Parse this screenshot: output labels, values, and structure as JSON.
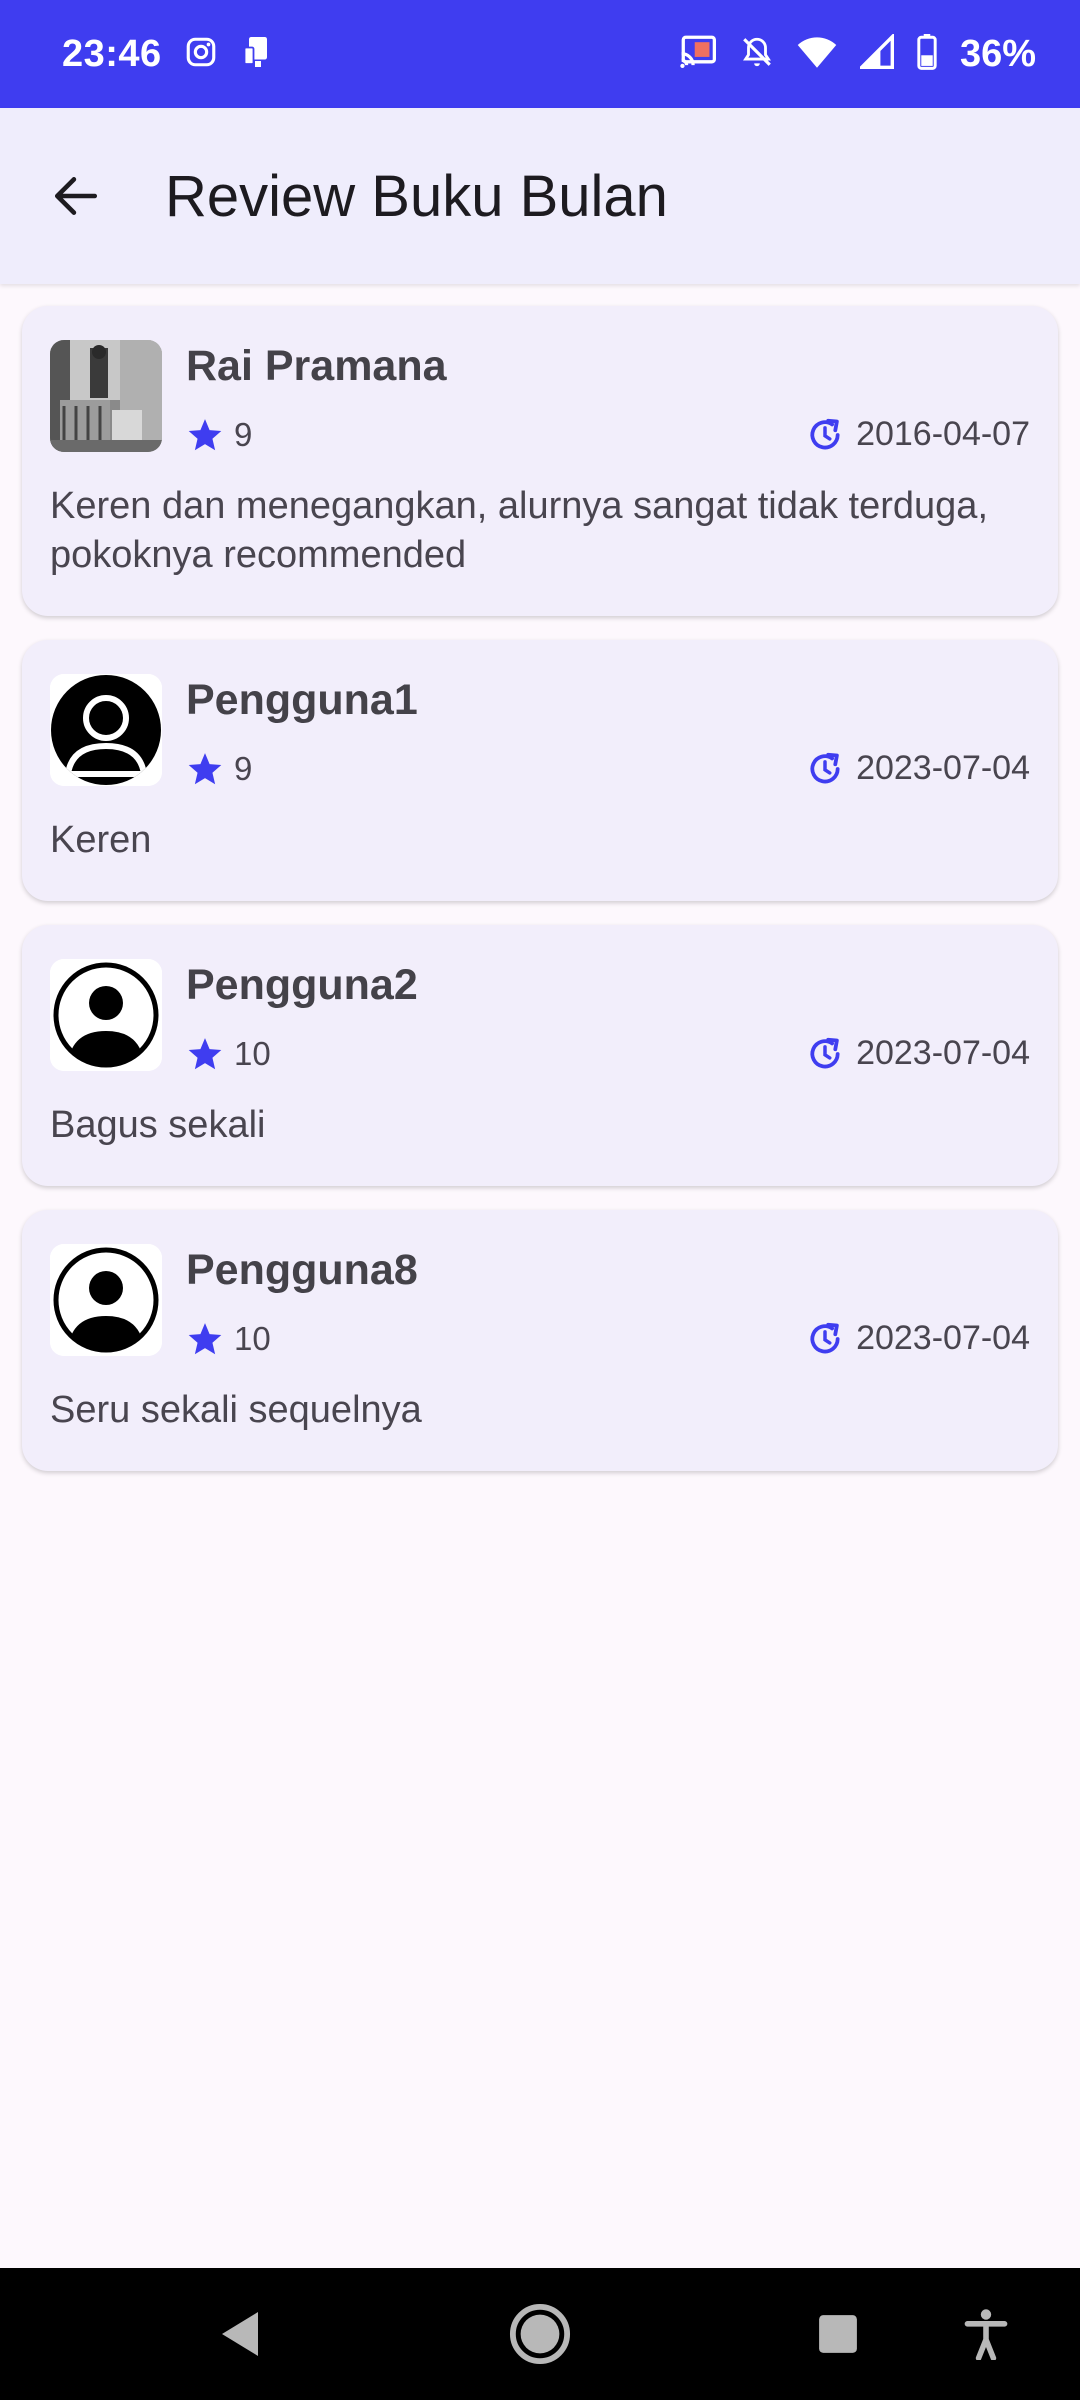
{
  "status_bar": {
    "time": "23:46",
    "battery": "36%",
    "icons_left": [
      "instagram-icon",
      "device-icon"
    ],
    "icons_right": [
      "cast-icon",
      "bell-off-icon",
      "wifi-icon",
      "signal-icon",
      "battery-icon"
    ]
  },
  "app_bar": {
    "title": "Review Buku Bulan",
    "back_icon": "arrow-back-icon"
  },
  "reviews": [
    {
      "name": "Rai Pramana",
      "rating": "9",
      "date": "2016-04-07",
      "text": "Keren dan menegangkan, alurnya sangat tidak terduga, pokoknya recommended",
      "avatar": "photo"
    },
    {
      "name": "Pengguna1",
      "rating": "9",
      "date": "2023-07-04",
      "text": "Keren",
      "avatar": "default-avatar-filled"
    },
    {
      "name": "Pengguna2",
      "rating": "10",
      "date": "2023-07-04",
      "text": "Bagus sekali",
      "avatar": "default-avatar-outline"
    },
    {
      "name": "Pengguna8",
      "rating": "10",
      "date": "2023-07-04",
      "text": "Seru sekali sequelnya",
      "avatar": "default-avatar-outline"
    }
  ],
  "colors": {
    "accent": "#3f3df0",
    "app_bar_bg": "#efedfc",
    "card_bg": "#f2eefb",
    "page_bg": "#fdf8fd"
  },
  "nav_bar": {
    "icons": [
      "back-triangle-icon",
      "home-circle-icon",
      "recents-square-icon",
      "accessibility-icon"
    ]
  }
}
